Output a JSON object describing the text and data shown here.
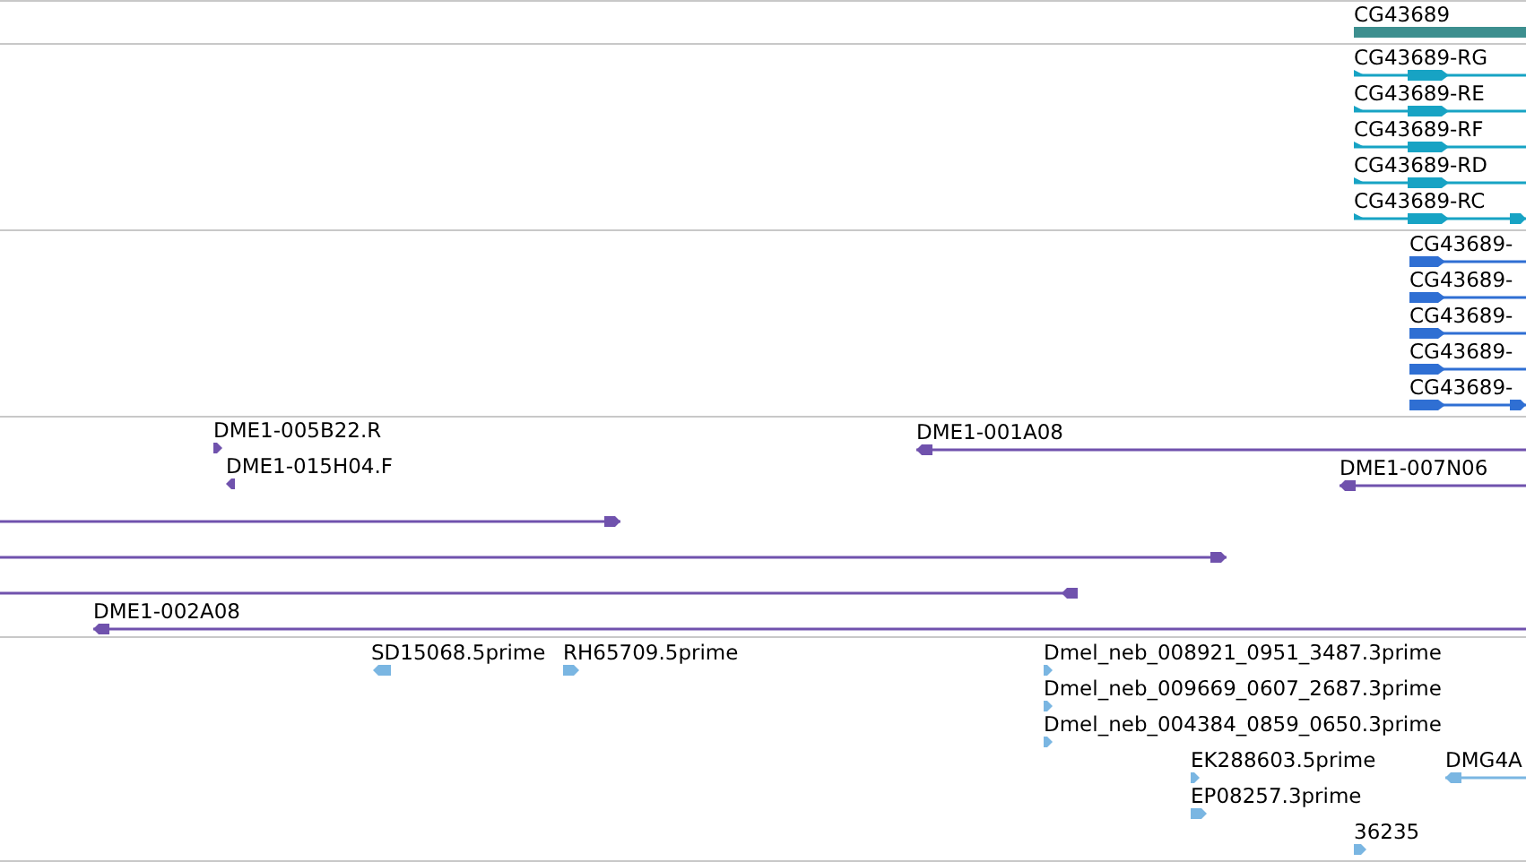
{
  "tracks": [
    {
      "color": "#3d8f8f",
      "features": [
        {
          "label": "CG43689"
        }
      ]
    },
    {
      "color": "#17a3c4",
      "features": [
        {
          "label": "CG43689-RG",
          "reverse": false
        },
        {
          "label": "CG43689-RE",
          "reverse": false
        },
        {
          "label": "CG43689-RF",
          "reverse": false
        },
        {
          "label": "CG43689-RD",
          "reverse": false
        },
        {
          "label": "CG43689-RC",
          "reverse": false
        }
      ]
    },
    {
      "color": "#2f6fd3",
      "features": [
        {
          "label": "CG43689-",
          "reverse": false
        },
        {
          "label": "CG43689-",
          "reverse": false
        },
        {
          "label": "CG43689-",
          "reverse": false
        },
        {
          "label": "CG43689-",
          "reverse": false
        },
        {
          "label": "CG43689-",
          "reverse": false
        }
      ]
    },
    {
      "color": "#7052ad",
      "features": [
        {
          "label": "DME1-005B22.R",
          "reverse": false
        },
        {
          "label": "DME1-001A08",
          "reverse": true
        },
        {
          "label": "DME1-015H04.F",
          "reverse": true
        },
        {
          "label": "DME1-007N06",
          "reverse": true
        },
        {
          "reverse": false
        },
        {
          "reverse": false
        },
        {
          "reverse": true
        },
        {
          "label": "DME1-002A08",
          "reverse": true
        }
      ]
    },
    {
      "color": "#7ab6e2",
      "features": [
        {
          "label": "SD15068.5prime",
          "reverse": true
        },
        {
          "label": "RH65709.5prime",
          "reverse": false
        },
        {
          "label": "Dmel_neb_008921_0951_3487.3prime",
          "reverse": false
        },
        {
          "label": "Dmel_neb_009669_0607_2687.3prime",
          "reverse": false
        },
        {
          "label": "Dmel_neb_004384_0859_0650.3prime",
          "reverse": false
        },
        {
          "label": "EK288603.5prime",
          "reverse": false
        },
        {
          "label": "DMG4A",
          "reverse": true
        },
        {
          "label": "EP08257.3prime",
          "reverse": false
        },
        {
          "label": "36235",
          "reverse": false
        }
      ]
    }
  ]
}
